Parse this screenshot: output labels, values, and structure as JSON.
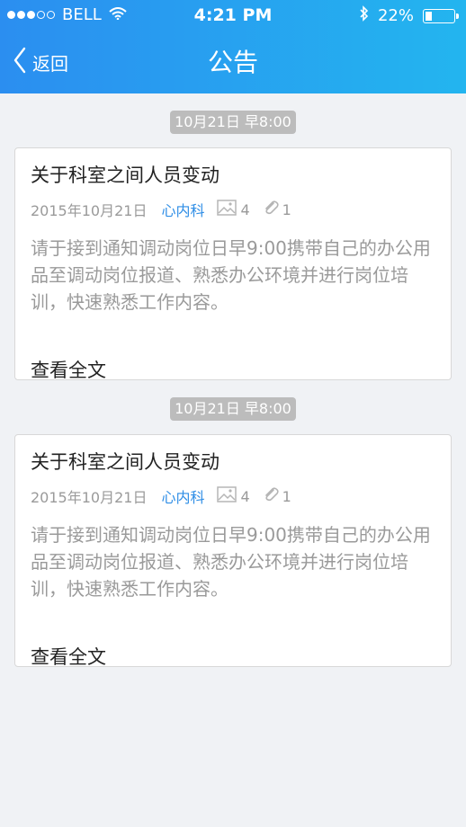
{
  "status": {
    "carrier": "BELL",
    "time": "4:21 PM",
    "battery": "22%",
    "battery_level": 0.22,
    "signal_dots_filled": 3,
    "signal_dots_total": 5
  },
  "nav": {
    "back_label": "返回",
    "title": "公告"
  },
  "notices": [
    {
      "date_pill": "10月21日 早8:00",
      "title": "关于科室之间人员变动",
      "date": "2015年10月21日",
      "dept": "心内科",
      "images": "4",
      "attachments": "1",
      "body": "请于接到通知调动岗位日早9:00携带自己的办公用品至调动岗位报道、熟悉办公环境并进行岗位培训，快速熟悉工作内容。",
      "read_more": "查看全文"
    },
    {
      "date_pill": "10月21日 早8:00",
      "title": "关于科室之间人员变动",
      "date": "2015年10月21日",
      "dept": "心内科",
      "images": "4",
      "attachments": "1",
      "body": "请于接到通知调动岗位日早9:00携带自己的办公用品至调动岗位报道、熟悉办公环境并进行岗位培训，快速熟悉工作内容。",
      "read_more": "查看全文"
    }
  ],
  "colors": {
    "header_start": "#2b8ef0",
    "header_end": "#23b5ef",
    "dept": "#2f8ee6",
    "muted": "#9a9a9a"
  },
  "icons": [
    "wifi-icon",
    "bluetooth-icon",
    "battery-icon",
    "back-chevron-icon",
    "image-icon",
    "paperclip-icon"
  ]
}
